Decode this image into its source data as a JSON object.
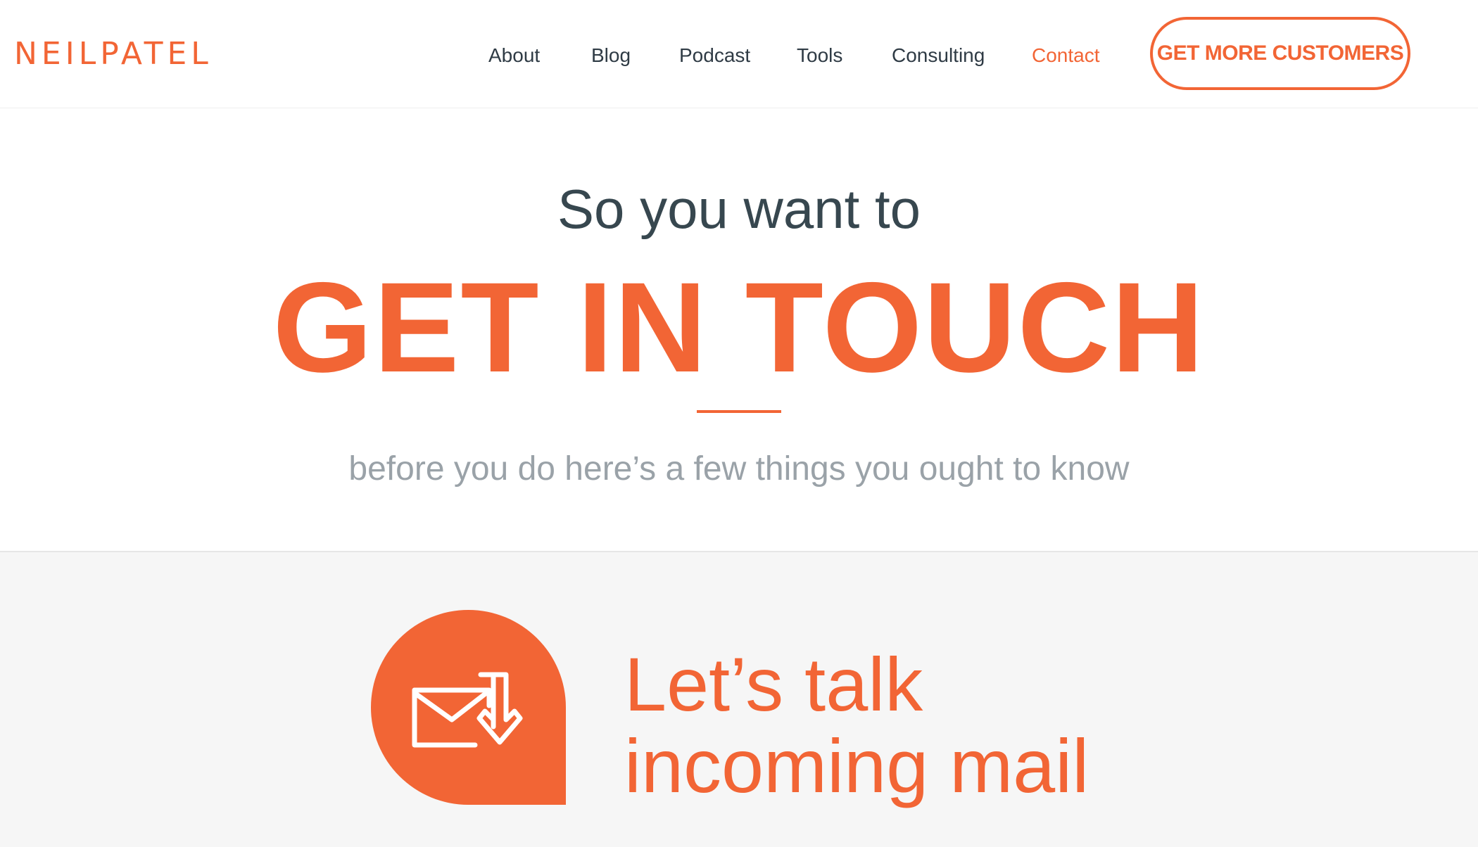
{
  "header": {
    "logo": "NEILPATEL",
    "nav": [
      {
        "label": "About",
        "active": false
      },
      {
        "label": "Blog",
        "active": false
      },
      {
        "label": "Podcast",
        "active": false
      },
      {
        "label": "Tools",
        "active": false
      },
      {
        "label": "Consulting",
        "active": false
      },
      {
        "label": "Contact",
        "active": true
      }
    ],
    "cta_label": "GET MORE CUSTOMERS"
  },
  "hero": {
    "pre_title": "So you want to",
    "title": "GET IN TOUCH",
    "subtitle": "before you do here’s a few things you ought to know"
  },
  "mail_section": {
    "icon": "mail-download-icon",
    "heading_line1": "Let’s talk",
    "heading_line2": "incoming mail"
  },
  "colors": {
    "accent": "#f26535",
    "text_dark": "#37474f",
    "text_muted": "#9aa2a8",
    "section_bg": "#f6f6f6"
  }
}
